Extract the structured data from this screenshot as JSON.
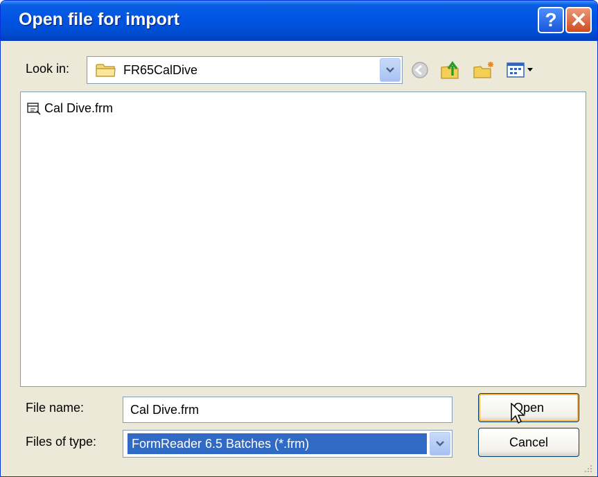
{
  "dialog": {
    "title": "Open file for import",
    "help_label": "?",
    "close_label": "✕"
  },
  "lookin": {
    "label": "Look in:",
    "value": "FR65CalDive"
  },
  "toolbar": {
    "icons": [
      "back-icon",
      "up-folder-icon",
      "new-folder-icon",
      "views-menu-icon"
    ]
  },
  "files": [
    {
      "name": "Cal Dive.frm",
      "icon": "form-batch-icon"
    }
  ],
  "filename": {
    "label": "File name:",
    "value": "Cal Dive.frm"
  },
  "filetype": {
    "label": "Files of type:",
    "value": "FormReader 6.5 Batches (*.frm)"
  },
  "buttons": {
    "open": "Open",
    "cancel": "Cancel"
  },
  "colors": {
    "titlebar": "#0054e3",
    "dialog_bg": "#ece9d8",
    "selection": "#316ac5",
    "focus_ring": "#f8b33c"
  }
}
